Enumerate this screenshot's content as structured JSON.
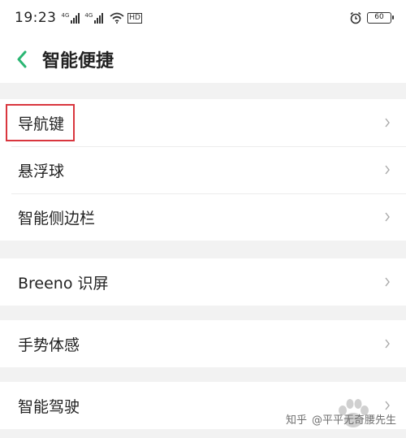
{
  "status_bar": {
    "time": "19:23",
    "signal1_tag": "4G",
    "signal2_tag": "4G",
    "hd_label": "HD",
    "battery_level": "60"
  },
  "header": {
    "title": "智能便捷"
  },
  "groups": [
    {
      "items": [
        {
          "label": "导航键",
          "highlighted": true
        },
        {
          "label": "悬浮球"
        },
        {
          "label": "智能侧边栏"
        }
      ]
    },
    {
      "items": [
        {
          "label": "Breeno 识屏"
        }
      ]
    },
    {
      "items": [
        {
          "label": "手势体感"
        }
      ]
    },
    {
      "items": [
        {
          "label": "智能驾驶"
        }
      ]
    }
  ],
  "watermark": {
    "site": "知乎",
    "author": "@平平无奇腰先生"
  },
  "colors": {
    "accent": "#2bb673",
    "highlight_border": "#d9363e",
    "background": "#f2f2f2",
    "row_background": "#ffffff"
  },
  "icons": [
    "back-arrow-icon",
    "chevron-right-icon",
    "wifi-icon",
    "alarm-clock-icon",
    "battery-icon"
  ]
}
